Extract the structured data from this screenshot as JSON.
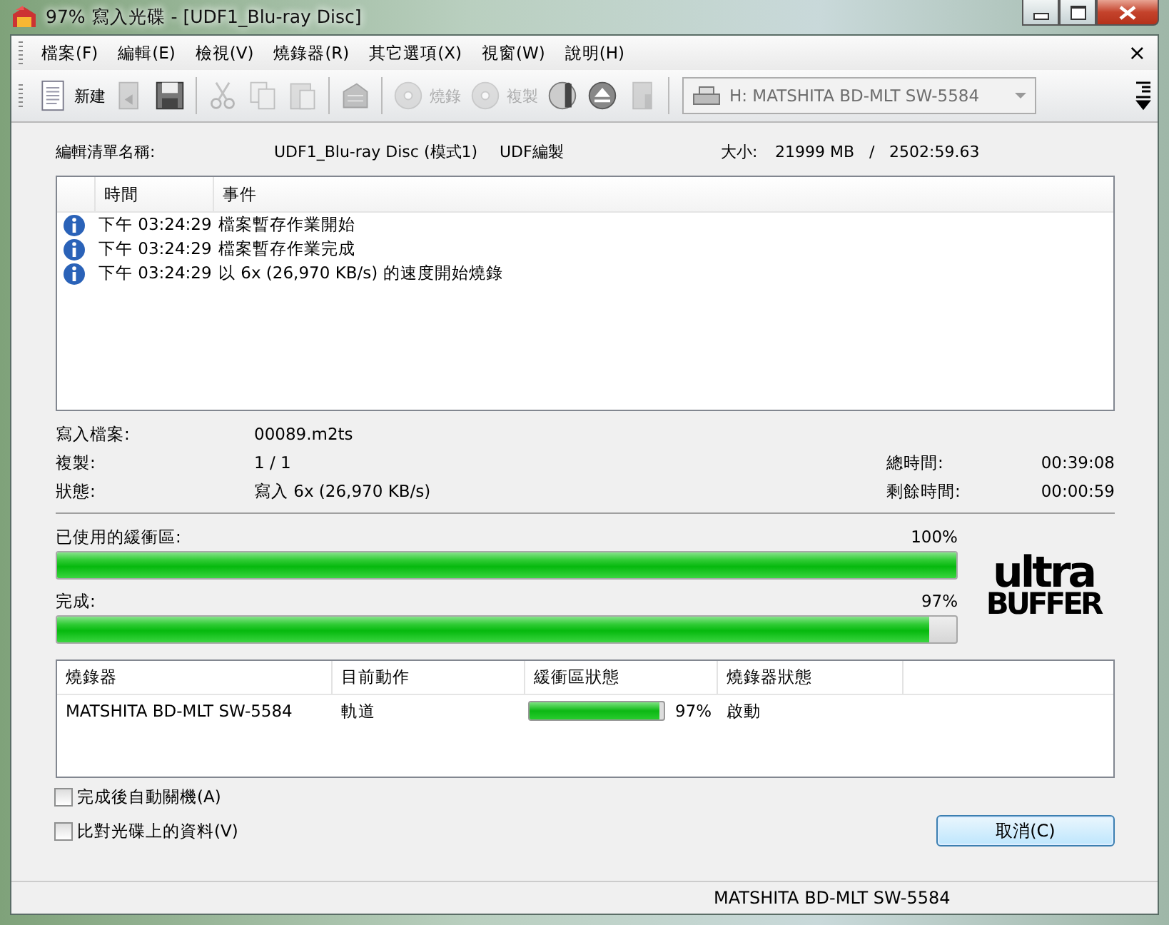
{
  "window": {
    "title": "97% 寫入光碟 - [UDF1_Blu-ray Disc]"
  },
  "menu": [
    {
      "label": "檔案(F)"
    },
    {
      "label": "編輯(E)"
    },
    {
      "label": "檢視(V)"
    },
    {
      "label": "燒錄器(R)"
    },
    {
      "label": "其它選項(X)"
    },
    {
      "label": "視窗(W)"
    },
    {
      "label": "說明(H)"
    }
  ],
  "menu_close": "×",
  "toolbar": [
    {
      "kind": "new",
      "label": "新建",
      "disabled": false
    },
    {
      "kind": "open",
      "disabled": true
    },
    {
      "kind": "save",
      "disabled": false
    },
    {
      "kind": "sep"
    },
    {
      "kind": "cut",
      "disabled": true
    },
    {
      "kind": "copy",
      "disabled": true
    },
    {
      "kind": "paste",
      "disabled": true
    },
    {
      "kind": "sep"
    },
    {
      "kind": "compile",
      "disabled": true
    },
    {
      "kind": "sep"
    },
    {
      "kind": "burn",
      "label": "燒錄",
      "disabled": true
    },
    {
      "kind": "disccopy",
      "label": "複製",
      "disabled": true
    },
    {
      "kind": "info",
      "disabled": false
    },
    {
      "kind": "eject",
      "disabled": false
    },
    {
      "kind": "erase",
      "disabled": true
    },
    {
      "kind": "sep"
    }
  ],
  "drive_select": {
    "value": "H: MATSHITA BD-MLT SW-5584",
    "disabled": true
  },
  "summary": {
    "name_label": "編輯清單名稱:",
    "name": "UDF1_Blu-ray Disc (模式1)",
    "type": "UDF編製",
    "size_label": "大小:",
    "size": "21999 MB",
    "sep": "/",
    "duration": "2502:59.63"
  },
  "log": {
    "columns": [
      "時間",
      "事件"
    ],
    "rows": [
      {
        "time": "下午 03:24:29",
        "event": "檔案暫存作業開始"
      },
      {
        "time": "下午 03:24:29",
        "event": "檔案暫存作業完成"
      },
      {
        "time": "下午 03:24:29",
        "event": "以 6x (26,970 KB/s) 的速度開始燒錄"
      }
    ]
  },
  "status": {
    "file_label": "寫入檔案:",
    "file": "00089.m2ts",
    "copies_label": "複製:",
    "copies": "1 / 1",
    "state_label": "狀態:",
    "state": "寫入 6x (26,970 KB/s)",
    "total_label": "總時間:",
    "total": "00:39:08",
    "remain_label": "剩餘時間:",
    "remain": "00:00:59"
  },
  "buffer": {
    "label": "已使用的緩衝區:",
    "reading": "100%",
    "level": 1.0
  },
  "progress": {
    "label": "完成:",
    "reading": "97%",
    "level": 0.97
  },
  "logo": {
    "top": "ultra",
    "bottom": "BUFFER"
  },
  "recorders": {
    "columns": [
      "燒錄器",
      "目前動作",
      "緩衝區狀態",
      "燒錄器狀態"
    ],
    "rows": [
      {
        "name": "MATSHITA BD-MLT SW-5584",
        "action": "軌道",
        "level": 0.97,
        "buffer_reading": "97%",
        "state": "啟動"
      }
    ]
  },
  "options": [
    {
      "label": "完成後自動關機(A)",
      "checked": false
    },
    {
      "label": "比對光碟上的資料(V)",
      "checked": false
    }
  ],
  "cancel_button": "取消(C)",
  "status_bar": "MATSHITA BD-MLT SW-5584"
}
